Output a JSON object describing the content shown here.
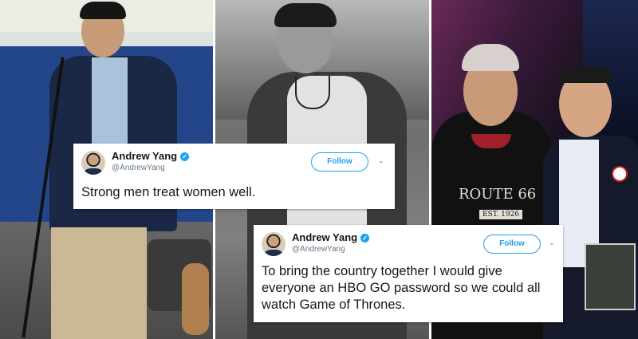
{
  "tweets": [
    {
      "author": "Andrew Yang",
      "handle": "@AndrewYang",
      "follow_label": "Follow",
      "text": "Strong men treat women well."
    },
    {
      "author": "Andrew Yang",
      "handle": "@AndrewYang",
      "follow_label": "Follow",
      "text": "To bring the country together I would give everyone an HBO GO password so we could all watch Game of Thrones."
    }
  ],
  "photo_text": {
    "hoodie_print": "ROUTE 66",
    "hoodie_badge": "EST. 1926"
  },
  "colors": {
    "twitter_blue": "#1da1f2",
    "text_dark": "#14171a",
    "text_muted": "#657786"
  },
  "icons": [
    "verified-badge-icon",
    "chevron-down-icon"
  ]
}
